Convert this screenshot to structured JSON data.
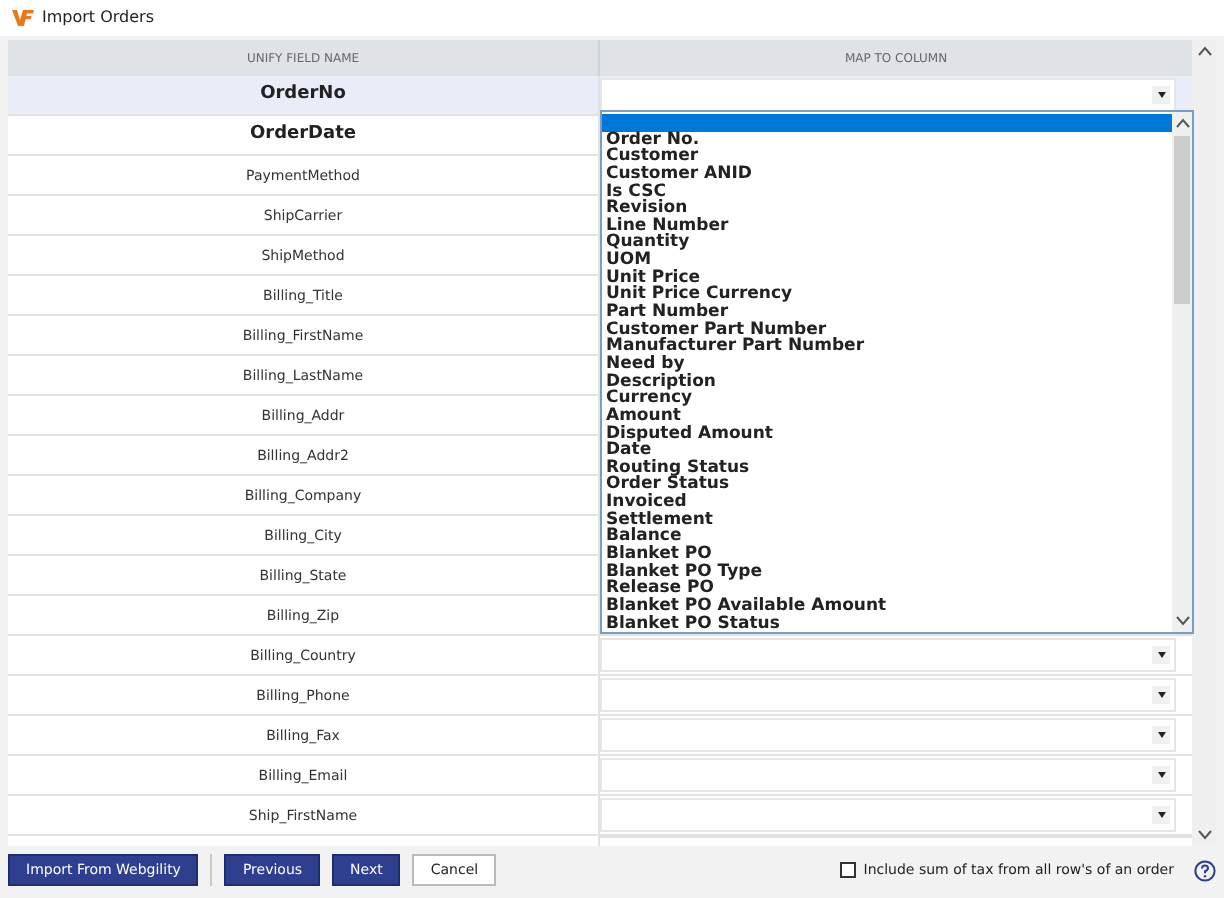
{
  "window": {
    "title": "Import Orders"
  },
  "table": {
    "columns": [
      "UNIFY FIELD NAME",
      "MAP TO COLUMN"
    ],
    "rows": [
      {
        "field": "OrderNo",
        "required": true,
        "selected": true
      },
      {
        "field": "OrderDate",
        "required": true,
        "selected": false
      },
      {
        "field": "PaymentMethod",
        "required": false,
        "selected": false
      },
      {
        "field": "ShipCarrier",
        "required": false,
        "selected": false
      },
      {
        "field": "ShipMethod",
        "required": false,
        "selected": false
      },
      {
        "field": "Billing_Title",
        "required": false,
        "selected": false
      },
      {
        "field": "Billing_FirstName",
        "required": false,
        "selected": false
      },
      {
        "field": "Billing_LastName",
        "required": false,
        "selected": false
      },
      {
        "field": "Billing_Addr",
        "required": false,
        "selected": false
      },
      {
        "field": "Billing_Addr2",
        "required": false,
        "selected": false
      },
      {
        "field": "Billing_Company",
        "required": false,
        "selected": false
      },
      {
        "field": "Billing_City",
        "required": false,
        "selected": false
      },
      {
        "field": "Billing_State",
        "required": false,
        "selected": false
      },
      {
        "field": "Billing_Zip",
        "required": false,
        "selected": false
      },
      {
        "field": "Billing_Country",
        "required": false,
        "selected": false
      },
      {
        "field": "Billing_Phone",
        "required": false,
        "selected": false
      },
      {
        "field": "Billing_Fax",
        "required": false,
        "selected": false
      },
      {
        "field": "Billing_Email",
        "required": false,
        "selected": false
      },
      {
        "field": "Ship_FirstName",
        "required": false,
        "selected": false
      }
    ]
  },
  "dropdown": {
    "expanded": true,
    "options": [
      {
        "selected": true
      },
      {
        "label": "Order No.",
        "selected": false
      },
      {
        "label": "Customer",
        "selected": false
      },
      {
        "label": "Customer ANID",
        "selected": false
      },
      {
        "label": "Is CSC",
        "selected": false
      },
      {
        "label": "Revision",
        "selected": false
      },
      {
        "label": "Line Number",
        "selected": false
      },
      {
        "label": "Quantity",
        "selected": false
      },
      {
        "label": "UOM",
        "selected": false
      },
      {
        "label": "Unit Price",
        "selected": false
      },
      {
        "label": "Unit Price Currency",
        "selected": false
      },
      {
        "label": "Part Number",
        "selected": false
      },
      {
        "label": "Customer Part Number",
        "selected": false
      },
      {
        "label": "Manufacturer Part Number",
        "selected": false
      },
      {
        "label": "Need by",
        "selected": false
      },
      {
        "label": "Description",
        "selected": false
      },
      {
        "label": "Currency",
        "selected": false
      },
      {
        "label": "Amount",
        "selected": false
      },
      {
        "label": "Disputed Amount",
        "selected": false
      },
      {
        "label": "Date",
        "selected": false
      },
      {
        "label": "Routing Status",
        "selected": false
      },
      {
        "label": "Order Status",
        "selected": false
      },
      {
        "label": "Invoiced",
        "selected": false
      },
      {
        "label": "Settlement",
        "selected": false
      },
      {
        "label": "Balance",
        "selected": false
      },
      {
        "label": "Blanket PO",
        "selected": false
      },
      {
        "label": "Blanket PO Type",
        "selected": false
      },
      {
        "label": "Release PO",
        "selected": false
      },
      {
        "label": "Blanket PO Available Amount",
        "selected": false
      },
      {
        "label": "Blanket PO Status",
        "selected": false
      }
    ]
  },
  "buttons": [
    {
      "label": "Import From Webgility",
      "kind": "primary"
    },
    {
      "label": "Previous",
      "kind": "primary"
    },
    {
      "label": "Next",
      "kind": "primary"
    },
    {
      "label": "Cancel",
      "kind": "secondary"
    }
  ],
  "tax_option": {
    "label": "Include sum of tax from all row's of an order",
    "checked": false
  }
}
